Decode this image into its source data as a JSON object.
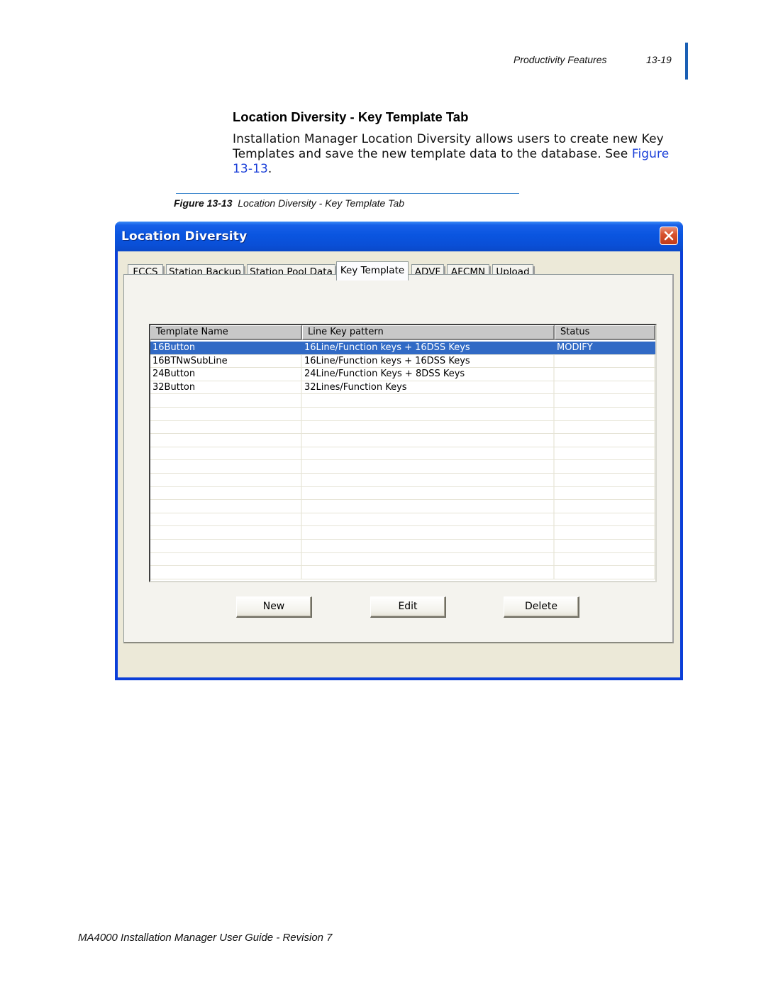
{
  "page_header": {
    "section": "Productivity Features",
    "page_number": "13-19"
  },
  "section_title": "Location Diversity - Key Template Tab",
  "body": {
    "text": "Installation Manager Location Diversity allows users to create new Key Templates and save the new template data to the database. See ",
    "link": "Figure 13-13",
    "trailing": "."
  },
  "figure_caption": {
    "label": "Figure 13-13",
    "title": "Location Diversity - Key Template Tab"
  },
  "window": {
    "title": "Location Diversity",
    "close_icon": "close-icon",
    "colors": {
      "titlebar": "#0a55e0",
      "client": "#ece9d8",
      "selection": "#316ac5",
      "close": "#d8522e"
    },
    "tabs": [
      {
        "label": "FCCS",
        "active": false
      },
      {
        "label": "Station Backup",
        "active": false
      },
      {
        "label": "Station Pool Data",
        "active": false
      },
      {
        "label": "Key Template",
        "active": true
      },
      {
        "label": "ADVF",
        "active": false
      },
      {
        "label": "AFCMN",
        "active": false
      },
      {
        "label": "Upload",
        "active": false
      }
    ],
    "table": {
      "columns": [
        "Template Name",
        "Line Key pattern",
        "Status"
      ],
      "rows": [
        {
          "name": "16Button",
          "pattern": "16Line/Function keys + 16DSS Keys",
          "status": "MODIFY",
          "selected": true
        },
        {
          "name": "16BTNwSubLine",
          "pattern": "16Line/Function keys + 16DSS Keys",
          "status": "",
          "selected": false
        },
        {
          "name": "24Button",
          "pattern": "24Line/Function Keys + 8DSS Keys",
          "status": "",
          "selected": false
        },
        {
          "name": "32Button",
          "pattern": "32Lines/Function Keys",
          "status": "",
          "selected": false
        }
      ],
      "empty_rows": 14
    },
    "buttons": {
      "new": "New",
      "edit": "Edit",
      "delete": "Delete"
    }
  },
  "footer": "MA4000 Installation Manager User Guide - Revision 7"
}
